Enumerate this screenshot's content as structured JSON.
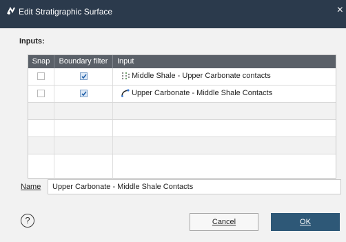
{
  "window": {
    "title": "Edit Stratigraphic Surface",
    "close_glyph": "×",
    "app_icon": "leapfrog-app-icon"
  },
  "inputs": {
    "label": "Inputs:",
    "columns": [
      "Snap",
      "Boundary filter",
      "Input"
    ],
    "rows": [
      {
        "snap": false,
        "boundary_filter": true,
        "icon": "contact-points-icon",
        "input": "Middle Shale - Upper Carbonate contacts"
      },
      {
        "snap": false,
        "boundary_filter": true,
        "icon": "polyline-icon",
        "input": "Upper Carbonate - Middle Shale Contacts"
      }
    ]
  },
  "name": {
    "label": "Name",
    "value": "Upper Carbonate - Middle Shale Contacts"
  },
  "buttons": {
    "help": "?",
    "cancel": "Cancel",
    "ok": "OK"
  },
  "colors": {
    "titlebar": "#2b3a4c",
    "grid_header": "#5a6068",
    "ok_button": "#2e5877",
    "check": "#1f5fa8"
  }
}
